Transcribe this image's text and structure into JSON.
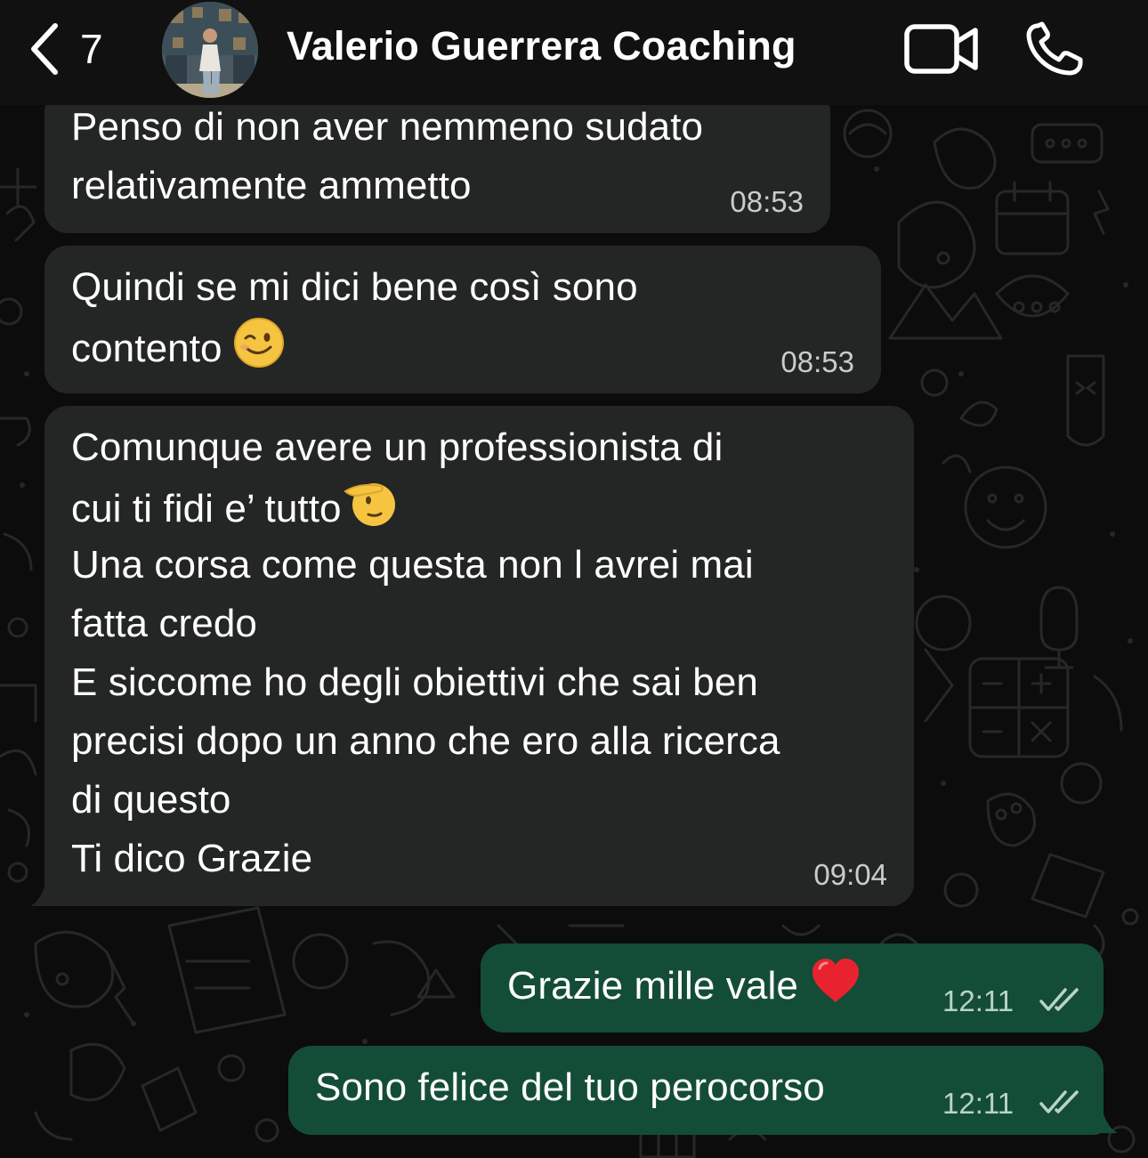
{
  "header": {
    "back_count": "7",
    "contact_name": "Valerio Guerrera Coaching",
    "icons": [
      "chevron-left-icon",
      "video-camera-icon",
      "phone-icon"
    ]
  },
  "colors": {
    "background": "#0c0c0c",
    "header": "#111111",
    "incoming_bubble": "#242626",
    "outgoing_bubble": "#144d37",
    "text": "#ffffff",
    "time": "#c9cccc"
  },
  "messages": [
    {
      "direction": "incoming",
      "lines": [
        "Penso di non aver nemmeno sudato",
        "relativamente ammetto"
      ],
      "time": "08:53"
    },
    {
      "direction": "incoming",
      "line1": "Quindi se mi dici bene così sono",
      "line2": "contento",
      "emoji": "winking-face-emoji",
      "time": "08:53"
    },
    {
      "direction": "incoming",
      "line1": "Comunque avere un professionista di",
      "line2": "cui ti fidi e’ tutto",
      "emoji": "saluting-face-emoji",
      "rest": [
        "Una corsa come questa non l avrei mai",
        "fatta credo",
        "E siccome ho degli obiettivi che sai ben",
        "precisi dopo un anno che ero alla ricerca",
        "di questo",
        "Ti dico Grazie"
      ],
      "time": "09:04"
    },
    {
      "direction": "outgoing",
      "text": "Grazie mille vale",
      "emoji": "red-heart-emoji",
      "time": "12:11",
      "status": "read-ticks-icon"
    },
    {
      "direction": "outgoing",
      "text": "Sono felice del tuo perocorso",
      "time": "12:11",
      "status": "read-ticks-icon"
    }
  ]
}
